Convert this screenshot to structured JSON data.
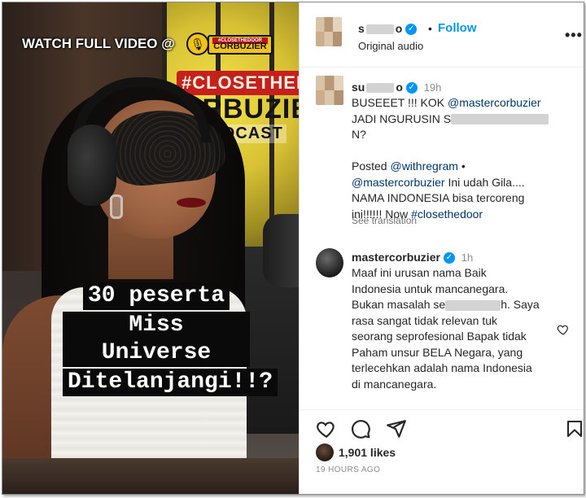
{
  "media": {
    "watch_label": "WATCH FULL VIDEO @",
    "logo_top": "#CLOSETHEDOOR",
    "logo_bottom": "CORBUZIER",
    "sign_hashtag": "#CLOSETHEDOO",
    "sign_name": "ORBUZIE",
    "sign_podcast": "PODCAST",
    "caption_lines": [
      "30 peserta",
      "Miss Universe",
      "Ditelanjangi!!?"
    ]
  },
  "post": {
    "author_visible": "s",
    "author_tail": "o",
    "follow_label": "Follow",
    "audio_label": "Original audio",
    "caption": {
      "user_visible": "su",
      "user_tail": "o",
      "time": "19h",
      "line1": "BUSEEET !!! KOK",
      "line1_mention": "@mastercorbuzier",
      "line2_start": "JADI NGURUSIN S",
      "line2_end": "N?",
      "posted_prefix": "Posted",
      "posted_mention": "@withregram",
      "posted_sep": " •",
      "body_mention": "@mastercorbuzier",
      "body_rest": " Ini udah Gila....",
      "line4": "NAMA INDONESIA bisa tercoreng",
      "line5_start": "ini!!!!!! Now",
      "hashtag": "#closethedoor",
      "see_translation": "See translation"
    },
    "reply": {
      "user": "mastercorbuzier",
      "time": "1h",
      "line1": "Maaf ini urusan nama Baik",
      "line2": "Indonesia untuk mancanegara.",
      "line3_start": "Bukan masalah se",
      "line3_end": "h. Saya",
      "line4": "rasa sangat tidak relevan tuk",
      "line5": "seorang seprofesional Bapak tidak",
      "line6": "Paham unsur BELA Negara, yang",
      "line7": "terlecehkan adalah nama Indonesia",
      "line8": "di mancanegara."
    },
    "likes": "1,901 likes",
    "timestamp": "19 HOURS AGO",
    "icons": {
      "verified": "verified-badge-icon",
      "more": "more-options-icon",
      "like": "heart-icon",
      "comment": "comment-icon",
      "share": "send-icon",
      "save": "bookmark-icon"
    },
    "colors": {
      "link_blue": "#0095f6",
      "mention": "#00376b",
      "muted": "#8e8e8e"
    }
  }
}
